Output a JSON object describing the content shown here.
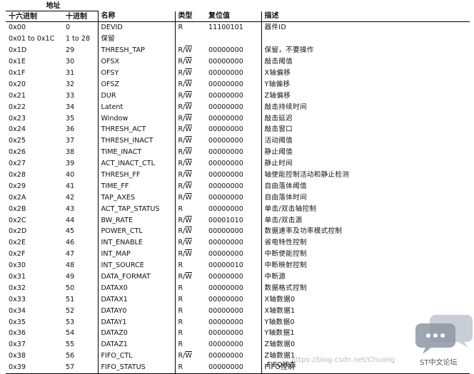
{
  "header": {
    "address_group": "地址",
    "hex": "十六进制",
    "dec": "十进制",
    "name": "名称",
    "type": "类型",
    "reset": "复位值",
    "desc": "描述"
  },
  "rows": [
    {
      "hex": "0x00",
      "dec": "0",
      "name": "DEVID",
      "type_r": "R",
      "type_w": "",
      "reset": "11100101",
      "desc": "器件ID"
    },
    {
      "hex": "0x01 to 0x1C",
      "dec": "1 to 28",
      "name": "保留",
      "type_r": "",
      "type_w": "",
      "reset": "",
      "desc": ""
    },
    {
      "hex": "0x1D",
      "dec": "29",
      "name": "THRESH_TAP",
      "type_r": "R/",
      "type_w": "W",
      "reset": "00000000",
      "desc": "保留，不要操作"
    },
    {
      "hex": "0x1E",
      "dec": "30",
      "name": "OFSX",
      "type_r": "R/",
      "type_w": "W",
      "reset": "00000000",
      "desc": "敲击阈值"
    },
    {
      "hex": "0x1F",
      "dec": "31",
      "name": "OFSY",
      "type_r": "R/",
      "type_w": "W",
      "reset": "00000000",
      "desc": "X轴偏移"
    },
    {
      "hex": "0x20",
      "dec": "32",
      "name": "OFSZ",
      "type_r": "R/",
      "type_w": "W",
      "reset": "00000000",
      "desc": "Y轴偏移"
    },
    {
      "hex": "0x21",
      "dec": "33",
      "name": "DUR",
      "type_r": "R/",
      "type_w": "W",
      "reset": "00000000",
      "desc": "Z轴偏移"
    },
    {
      "hex": "0x22",
      "dec": "34",
      "name": "Latent",
      "type_r": "R/",
      "type_w": "W",
      "reset": "00000000",
      "desc": "敲击持续时间"
    },
    {
      "hex": "0x23",
      "dec": "35",
      "name": "Window",
      "type_r": "R/",
      "type_w": "W",
      "reset": "00000000",
      "desc": "敲击延迟"
    },
    {
      "hex": "0x24",
      "dec": "36",
      "name": "THRESH_ACT",
      "type_r": "R/",
      "type_w": "W",
      "reset": "00000000",
      "desc": "敲击窗口"
    },
    {
      "hex": "0x25",
      "dec": "37",
      "name": "THRESH_INACT",
      "type_r": "R/",
      "type_w": "W",
      "reset": "00000000",
      "desc": "活动阈值"
    },
    {
      "hex": "0x26",
      "dec": "38",
      "name": "TIME_INACT",
      "type_r": "R/",
      "type_w": "W",
      "reset": "00000000",
      "desc": "静止阈值"
    },
    {
      "hex": "0x27",
      "dec": "39",
      "name": "ACT_INACT_CTL",
      "type_r": "R/",
      "type_w": "W",
      "reset": "00000000",
      "desc": "静止时间"
    },
    {
      "hex": "0x28",
      "dec": "40",
      "name": "THRESH_FF",
      "type_r": "R/",
      "type_w": "W",
      "reset": "00000000",
      "desc": "轴使能控制活动和静止检测"
    },
    {
      "hex": "0x29",
      "dec": "41",
      "name": "TIME_FF",
      "type_r": "R/",
      "type_w": "W",
      "reset": "00000000",
      "desc": "自由落体阈值"
    },
    {
      "hex": "0x2A",
      "dec": "42",
      "name": "TAP_AXES",
      "type_r": "R/",
      "type_w": "W",
      "reset": "00000000",
      "desc": "自由落体时间"
    },
    {
      "hex": "0x2B",
      "dec": "43",
      "name": "ACT_TAP_STATUS",
      "type_r": "R",
      "type_w": "",
      "reset": "00000000",
      "desc": "单击/双击轴控制"
    },
    {
      "hex": "0x2C",
      "dec": "44",
      "name": "BW_RATE",
      "type_r": "R/",
      "type_w": "W",
      "reset": "00001010",
      "desc": "单击/双击源"
    },
    {
      "hex": "0x2D",
      "dec": "45",
      "name": "POWER_CTL",
      "type_r": "R/",
      "type_w": "W",
      "reset": "00000000",
      "desc": "数据速率及功率模式控制"
    },
    {
      "hex": "0x2E",
      "dec": "46",
      "name": "INT_ENABLE",
      "type_r": "R/",
      "type_w": "W",
      "reset": "00000000",
      "desc": "省电特性控制"
    },
    {
      "hex": "0x2F",
      "dec": "47",
      "name": "INT_MAP",
      "type_r": "R/",
      "type_w": "W",
      "reset": "00000000",
      "desc": "中断使能控制"
    },
    {
      "hex": "0x30",
      "dec": "48",
      "name": "INT_SOURCE",
      "type_r": "R",
      "type_w": "",
      "reset": "00000010",
      "desc": "中断映射控制"
    },
    {
      "hex": "0x31",
      "dec": "49",
      "name": "DATA_FORMAT",
      "type_r": "R/",
      "type_w": "W",
      "reset": "00000000",
      "desc": "中断源"
    },
    {
      "hex": "0x32",
      "dec": "50",
      "name": "DATAX0",
      "type_r": "R",
      "type_w": "",
      "reset": "00000000",
      "desc": "数据格式控制"
    },
    {
      "hex": "0x33",
      "dec": "51",
      "name": "DATAX1",
      "type_r": "R",
      "type_w": "",
      "reset": "00000000",
      "desc": "X轴数据0"
    },
    {
      "hex": "0x34",
      "dec": "52",
      "name": "DATAY0",
      "type_r": "R",
      "type_w": "",
      "reset": "00000000",
      "desc": "X轴数据1"
    },
    {
      "hex": "0x35",
      "dec": "53",
      "name": "DATAY1",
      "type_r": "R",
      "type_w": "",
      "reset": "00000000",
      "desc": "Y轴数据0"
    },
    {
      "hex": "0x36",
      "dec": "54",
      "name": "DATAZ0",
      "type_r": "R",
      "type_w": "",
      "reset": "00000000",
      "desc": "Y轴数据1"
    },
    {
      "hex": "0x37",
      "dec": "55",
      "name": "DATAZ1",
      "type_r": "R",
      "type_w": "",
      "reset": "00000000",
      "desc": "Z轴数据0"
    },
    {
      "hex": "0x38",
      "dec": "56",
      "name": "FIFO_CTL",
      "type_r": "R/",
      "type_w": "W",
      "reset": "00000000",
      "desc": "Z轴数据1"
    },
    {
      "hex": "0x39",
      "dec": "57",
      "name": "FIFO_STATUS",
      "type_r": "R",
      "type_w": "",
      "reset": "00000000",
      "desc": "FIFO控制"
    }
  ],
  "trailing_desc": "FIFO状态",
  "watermark": {
    "url": "https://blog.csdn.net/Chuang",
    "forum": "ST中文论坛",
    "logo_color": "#b0b8c4"
  }
}
